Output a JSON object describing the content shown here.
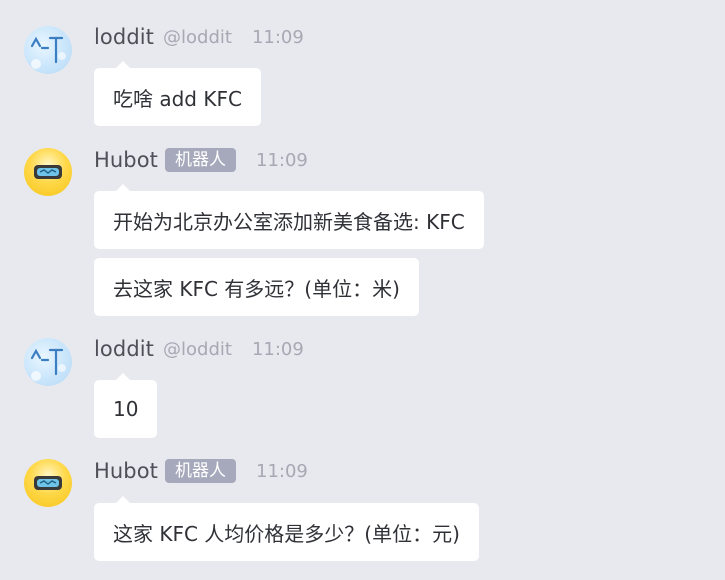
{
  "messages": [
    {
      "user": "loddit",
      "handle": "@loddit",
      "time": "11:09",
      "avatar_icon": "loddit-avatar",
      "bubbles": [
        "吃啥 add KFC"
      ]
    },
    {
      "user": "Hubot",
      "badge": "机器人",
      "time": "11:09",
      "avatar_icon": "hubot-avatar",
      "bubbles": [
        "开始为北京办公室添加新美食备选: KFC",
        "去这家 KFC 有多远？(单位：米)"
      ]
    },
    {
      "user": "loddit",
      "handle": "@loddit",
      "time": "11:09",
      "avatar_icon": "loddit-avatar",
      "bubbles": [
        "10"
      ]
    },
    {
      "user": "Hubot",
      "badge": "机器人",
      "time": "11:09",
      "avatar_icon": "hubot-avatar",
      "bubbles": [
        "这家 KFC 人均价格是多少？(单位：元)"
      ]
    }
  ],
  "colors": {
    "background": "#e8e9ee",
    "bubble": "#ffffff",
    "badge": "#a5a9bb",
    "meta_text": "#a6a9b4",
    "username": "#4d5058"
  }
}
